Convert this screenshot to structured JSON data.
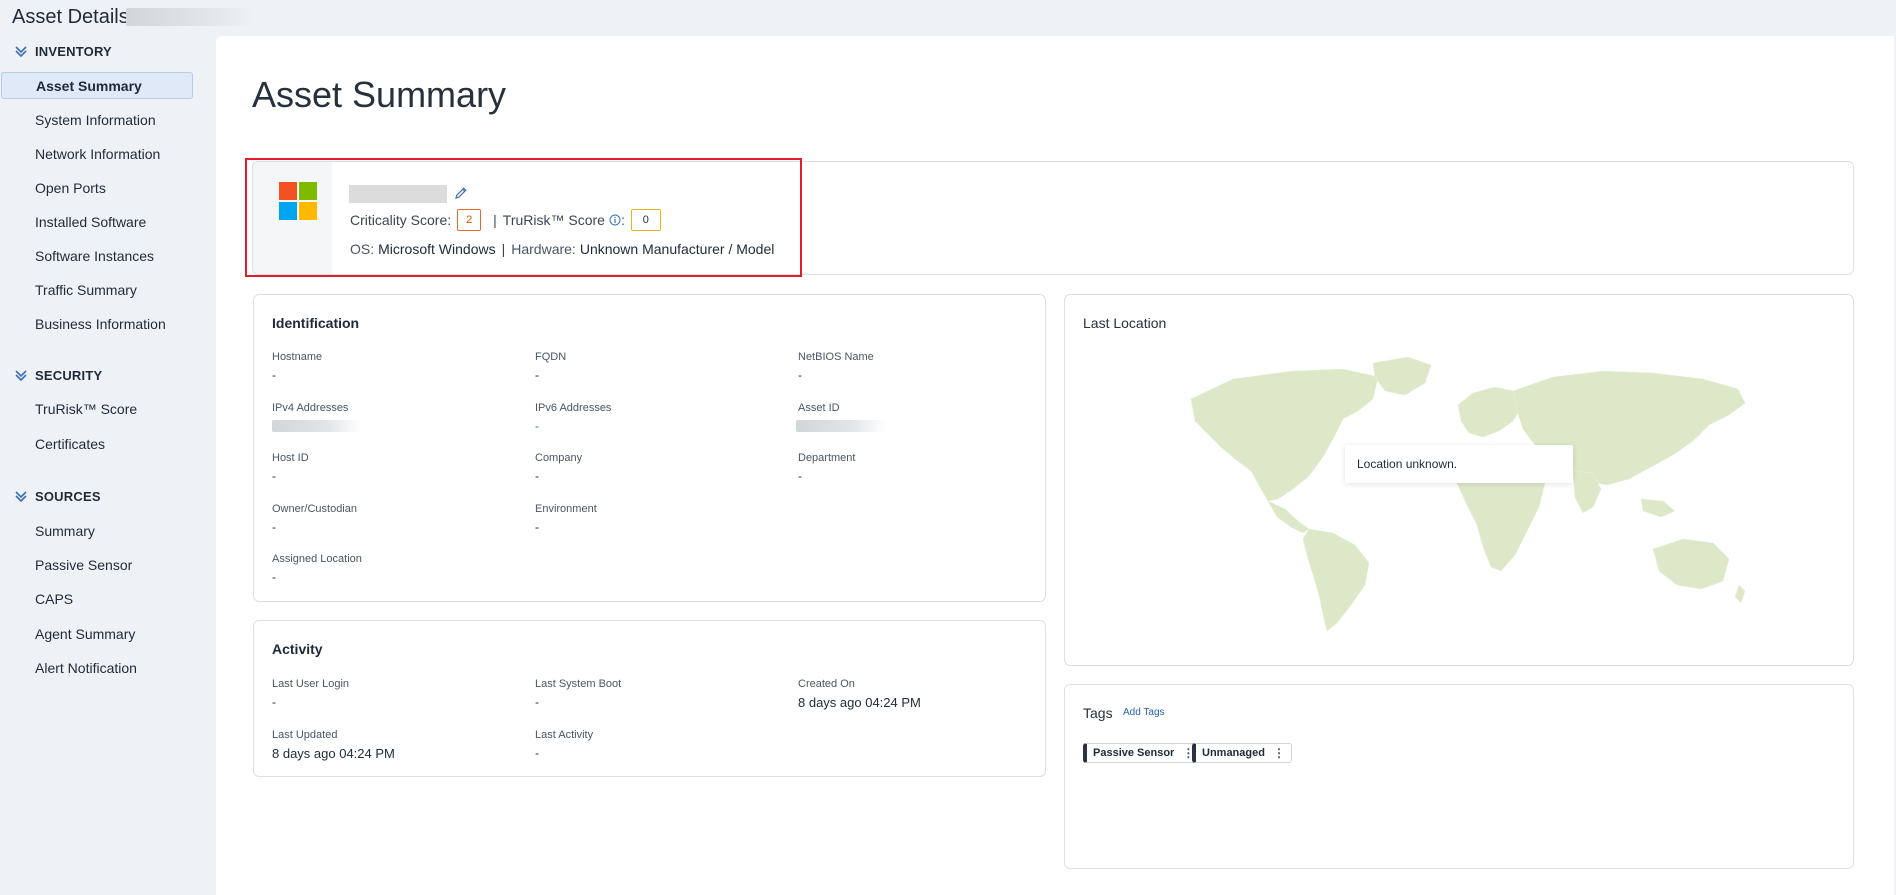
{
  "header": {
    "title": "Asset Details:"
  },
  "sidebar": {
    "sections": [
      {
        "title": "INVENTORY",
        "items": [
          "Asset Summary",
          "System Information",
          "Network Information",
          "Open Ports",
          "Installed Software",
          "Software Instances",
          "Traffic Summary",
          "Business Information"
        ]
      },
      {
        "title": "SECURITY",
        "items": [
          "TruRisk™ Score",
          "Certificates"
        ]
      },
      {
        "title": "SOURCES",
        "items": [
          "Summary",
          "Passive Sensor",
          "CAPS",
          "Agent Summary",
          "Alert Notification"
        ]
      }
    ],
    "active_item": "Asset Summary"
  },
  "main": {
    "page_title": "Asset Summary",
    "asset": {
      "criticality_label": "Criticality Score:",
      "criticality_value": "2",
      "trurisk_label": "TruRisk™ Score",
      "trurisk_colon": ":",
      "trurisk_value": "0",
      "pipe": "|",
      "os_label": "OS:",
      "os_value": "Microsoft Windows",
      "hardware_label": "Hardware:",
      "hardware_value": "Unknown Manufacturer / Model",
      "colors": {
        "criticality": "#e8692a",
        "trurisk": "#e6b422",
        "highlight": "#e11d2a"
      }
    },
    "identification": {
      "title": "Identification",
      "fields": [
        {
          "label": "Hostname",
          "value": "-"
        },
        {
          "label": "FQDN",
          "value": "-"
        },
        {
          "label": "NetBIOS Name",
          "value": "-"
        },
        {
          "label": "IPv4 Addresses",
          "value": ""
        },
        {
          "label": "IPv6 Addresses",
          "value": "-"
        },
        {
          "label": "Asset ID",
          "value": ""
        },
        {
          "label": "Host ID",
          "value": "-"
        },
        {
          "label": "Company",
          "value": "-"
        },
        {
          "label": "Department",
          "value": "-"
        },
        {
          "label": "Owner/Custodian",
          "value": "-"
        },
        {
          "label": "Environment",
          "value": "-"
        },
        {
          "label": "Assigned Location",
          "value": "-"
        }
      ]
    },
    "activity": {
      "title": "Activity",
      "fields": [
        {
          "label": "Last User Login",
          "value": "-"
        },
        {
          "label": "Last System Boot",
          "value": "-"
        },
        {
          "label": "Created On",
          "value": "8 days ago 04:24 PM"
        },
        {
          "label": "Last Updated",
          "value": "8 days ago 04:24 PM"
        },
        {
          "label": "Last Activity",
          "value": "-"
        }
      ]
    },
    "location": {
      "title": "Last Location",
      "message": "Location unknown."
    },
    "tags": {
      "title": "Tags",
      "add_label": "Add Tags",
      "items": [
        "Passive Sensor",
        "Unmanaged"
      ],
      "kebab": "⋮"
    }
  }
}
